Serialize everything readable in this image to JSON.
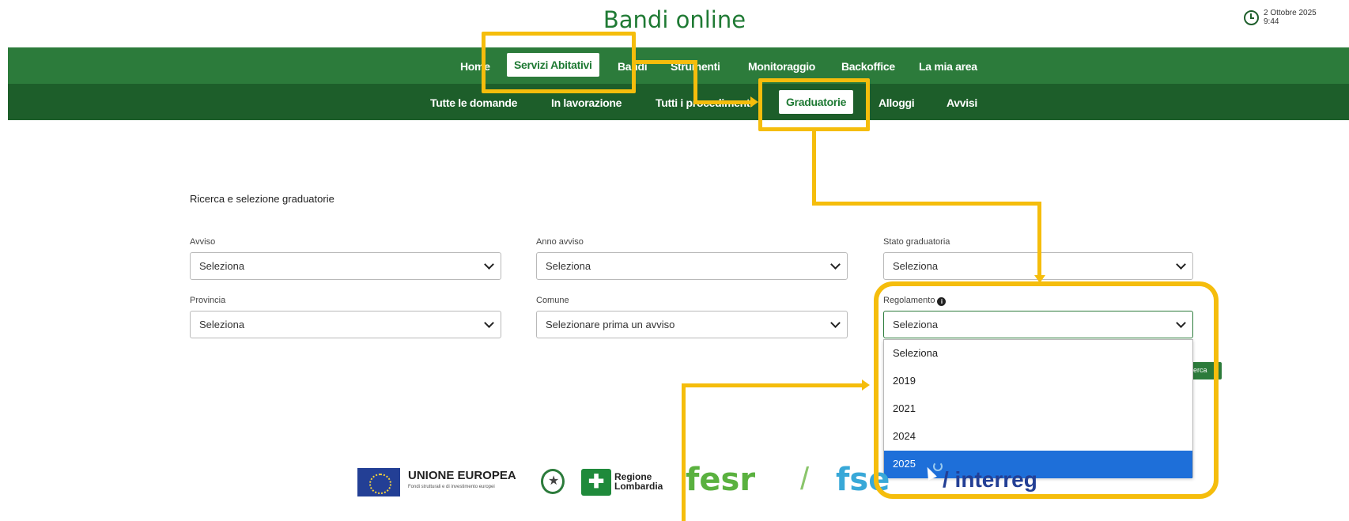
{
  "header": {
    "title": "Bandi online",
    "date": "2 Ottobre 2025",
    "time": "9:44"
  },
  "nav_top": [
    "Home",
    "Servizi Abitativi",
    "Bandi",
    "Strumenti",
    "Monitoraggio",
    "Backoffice",
    "La mia area"
  ],
  "nav_top_active": "Servizi Abitativi",
  "nav_sub": [
    "Tutte le domande",
    "In lavorazione",
    "Tutti i procedimenti",
    "Graduatorie",
    "Alloggi",
    "Avvisi"
  ],
  "nav_sub_active": "Graduatorie",
  "form": {
    "section_title": "Ricerca e selezione graduatorie",
    "fields": {
      "avviso": {
        "label": "Avviso",
        "value": "Seleziona"
      },
      "anno_avviso": {
        "label": "Anno avviso",
        "value": "Seleziona"
      },
      "stato_graduatoria": {
        "label": "Stato graduatoria",
        "value": "Seleziona"
      },
      "provincia": {
        "label": "Provincia",
        "value": "Seleziona"
      },
      "comune": {
        "label": "Comune",
        "value": "Selezionare prima un avviso"
      },
      "regolamento": {
        "label": "Regolamento",
        "value": "Seleziona"
      }
    },
    "regolamento_options": [
      "Seleziona",
      "2019",
      "2021",
      "2024",
      "2025"
    ],
    "regolamento_highlighted": "2025",
    "search_button_partial": "erca"
  },
  "footer": {
    "ue_title": "UNIONE EUROPEA",
    "ue_subtitle": "Fondi strutturali e di investimento europei",
    "regione_line1": "Regione",
    "regione_line2": "Lombardia",
    "fesr": "fesr",
    "slash": "/",
    "fse": "fse",
    "interreg": "/ interreg"
  },
  "icons": {
    "clock": "clock-icon",
    "info": "info-icon",
    "chevron": "chevron-down-icon"
  },
  "colors": {
    "brand_green": "#2c7b3b",
    "brand_green_dark": "#1d5e2a",
    "annotation_yellow": "#f5bd0c",
    "selection_blue": "#1e6fd9"
  }
}
